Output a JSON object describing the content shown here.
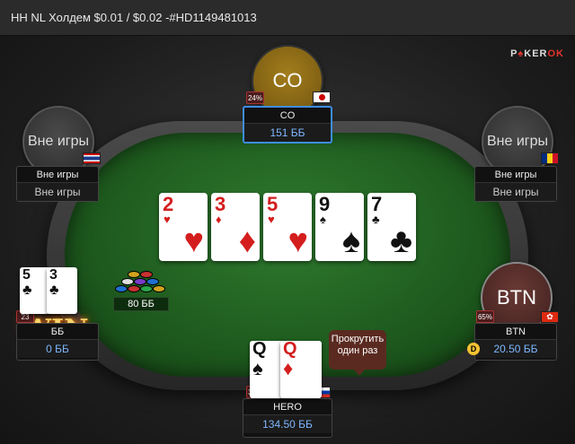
{
  "title": "HH NL Холдем $0.01 / $0.02 -#HD1149481013",
  "brand": {
    "prefix": "P",
    "accent": "♠",
    "rest": "KER",
    "end": "OK"
  },
  "board": [
    {
      "rank": "2",
      "suit": "♥",
      "color": "red"
    },
    {
      "rank": "3",
      "suit": "♦",
      "color": "red"
    },
    {
      "rank": "5",
      "suit": "♥",
      "color": "red"
    },
    {
      "rank": "9",
      "suit": "♠",
      "color": "black"
    },
    {
      "rank": "7",
      "suit": "♣",
      "color": "black"
    }
  ],
  "pot": "80 ББ",
  "seats": {
    "co": {
      "avatar": "CO",
      "pct": "24%",
      "name": "CO",
      "stack": "151 ББ",
      "flag": "japan"
    },
    "left_top": {
      "avatar": "Вне игры",
      "name": "Вне игры",
      "stack": "Вне игры",
      "flag": "thailand"
    },
    "right_top": {
      "avatar": "Вне игры",
      "name": "Вне игры",
      "stack": "Вне игры",
      "flag": "romania"
    },
    "bb": {
      "pct": "23",
      "name": "ББ",
      "stack": "0 ББ",
      "cards": [
        {
          "rank": "5",
          "suit": "♣"
        },
        {
          "rank": "3",
          "suit": "♣"
        }
      ],
      "win": "WIN"
    },
    "btn": {
      "avatar": "BTN",
      "pct": "65%",
      "name": "BTN",
      "stack": "20.50 ББ",
      "flag": "hongkong",
      "dealer": "D"
    },
    "hero": {
      "pct": "31%",
      "name": "HERO",
      "stack": "134.50 ББ",
      "flag": "russia",
      "cards": [
        {
          "rank": "Q",
          "suit": "♠",
          "color": "black"
        },
        {
          "rank": "Q",
          "suit": "♦",
          "color": "red"
        }
      ]
    }
  },
  "tooltip": "Прокрутить один раз"
}
